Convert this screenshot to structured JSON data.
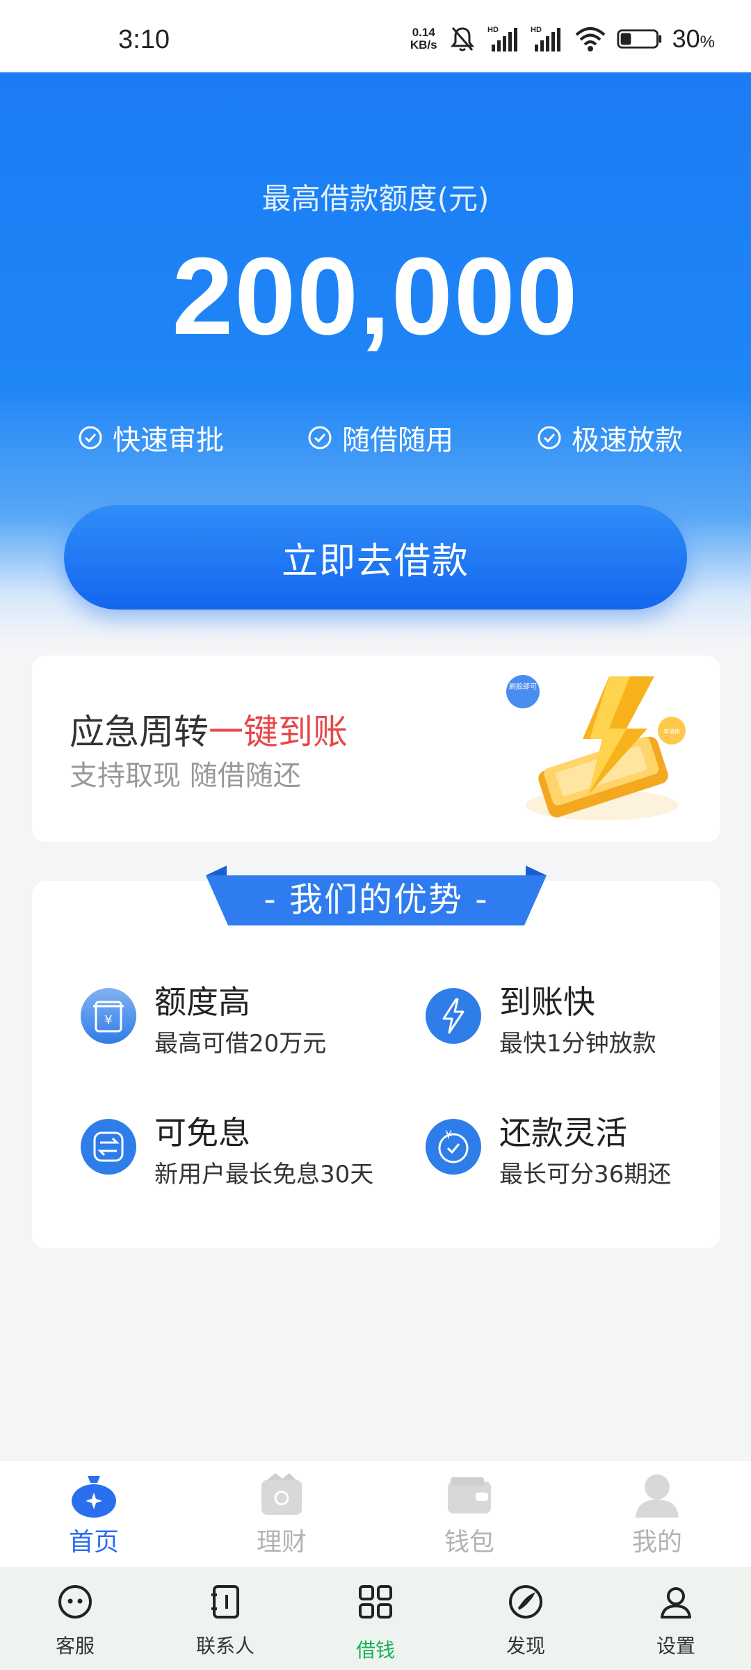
{
  "status_bar": {
    "time": "3:10",
    "net_speed_value": "0.14",
    "net_speed_unit": "KB/s",
    "battery_pct": "30",
    "battery_unit": "%",
    "battery_level": 0.3
  },
  "hero": {
    "label": "最高借款额度(元)",
    "amount": "200,000",
    "features": [
      "快速审批",
      "随借随用",
      "极速放款"
    ],
    "cta_label": "立即去借款"
  },
  "promo": {
    "title_main": "应急周转",
    "title_highlight": "一键到账",
    "subtitle": "支持取现 随借随还",
    "badge_left": "刷脸即可",
    "badge_right": "申请快"
  },
  "advantages": {
    "title": "- 我们的优势 -",
    "items": [
      {
        "name": "额度高",
        "desc": "最高可借20万元",
        "icon": "atm-icon"
      },
      {
        "name": "到账快",
        "desc": "最快1分钟放款",
        "icon": "lightning-icon"
      },
      {
        "name": "可免息",
        "desc": "新用户最长免息30天",
        "icon": "exchange-icon"
      },
      {
        "name": "还款灵活",
        "desc": "最长可分36期还",
        "icon": "clock-yuan-icon"
      }
    ]
  },
  "tabbar": {
    "tabs": [
      {
        "label": "首页",
        "icon": "money-bag-icon",
        "active": true
      },
      {
        "label": "理财",
        "icon": "finance-box-icon",
        "active": false
      },
      {
        "label": "钱包",
        "icon": "wallet-icon",
        "active": false
      },
      {
        "label": "我的",
        "icon": "user-icon",
        "active": false
      }
    ]
  },
  "sysnav": {
    "items": [
      {
        "label": "客服",
        "icon": "chat-face-icon"
      },
      {
        "label": "联系人",
        "icon": "contacts-icon"
      },
      {
        "label": "借钱",
        "icon": "grid-icon",
        "active": true
      },
      {
        "label": "发现",
        "icon": "compass-icon"
      },
      {
        "label": "设置",
        "icon": "person-outline-icon"
      }
    ]
  },
  "colors": {
    "primary": "#1b7cf5",
    "highlight": "#e8474a",
    "active_tab": "#2a6ff0",
    "active_nav": "#17b05a"
  }
}
